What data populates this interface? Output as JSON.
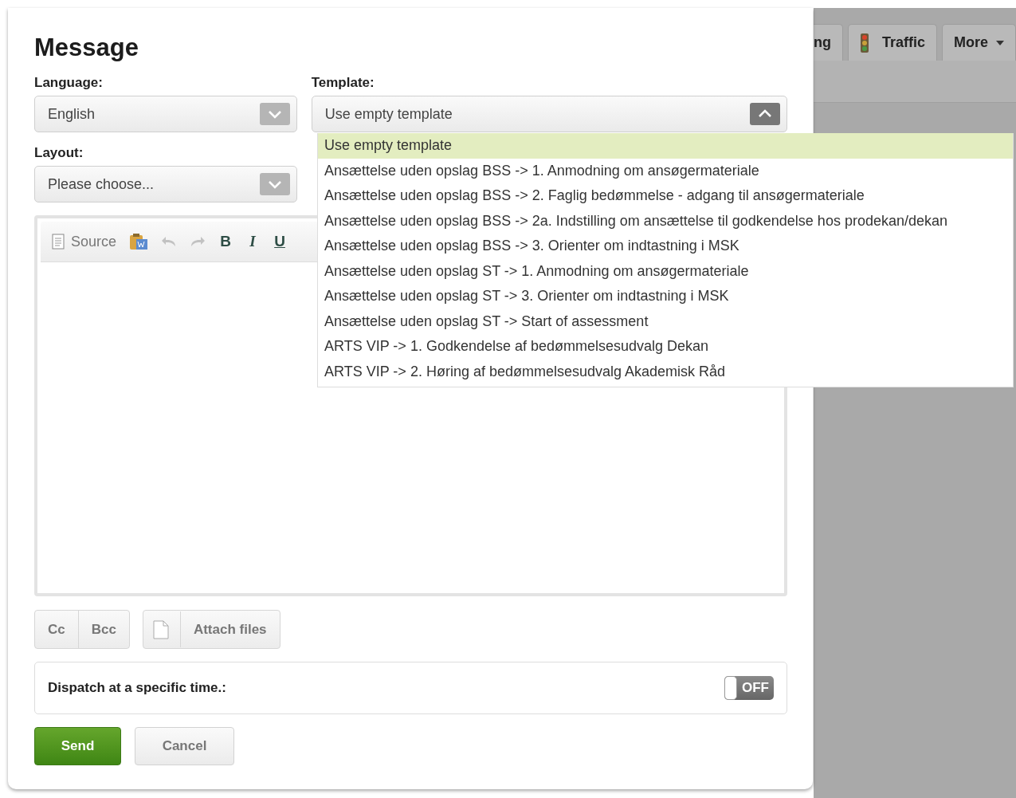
{
  "background_tabs": [
    {
      "kind": "plain",
      "label": "ng"
    },
    {
      "kind": "traffic",
      "label": "Traffic"
    },
    {
      "kind": "menu",
      "label": "More"
    }
  ],
  "dialog": {
    "title": "Message",
    "language": {
      "label": "Language:",
      "value": "English"
    },
    "template": {
      "label": "Template:",
      "value": "Use empty template",
      "expanded": true,
      "options": [
        {
          "label": "Use empty template",
          "selected": true
        },
        {
          "label": "Ansættelse uden opslag BSS -> 1. Anmodning om ansøgermateriale",
          "selected": false
        },
        {
          "label": "Ansættelse uden opslag BSS -> 2. Faglig bedømmelse - adgang til ansøgermateriale",
          "selected": false
        },
        {
          "label": "Ansættelse uden opslag BSS -> 2a. Indstilling om ansættelse til godkendelse hos prodekan/dekan",
          "selected": false
        },
        {
          "label": "Ansættelse uden opslag BSS -> 3. Orienter om indtastning i MSK",
          "selected": false
        },
        {
          "label": "Ansættelse uden opslag ST -> 1. Anmodning om ansøgermateriale",
          "selected": false
        },
        {
          "label": "Ansættelse uden opslag ST -> 3. Orienter om indtastning i MSK",
          "selected": false
        },
        {
          "label": "Ansættelse uden opslag ST -> Start of assessment",
          "selected": false
        },
        {
          "label": "ARTS VIP -> 1. Godkendelse af bedømmelsesudvalg Dekan",
          "selected": false
        },
        {
          "label": "ARTS VIP -> 2. Høring af bedømmelsesudvalg Akademisk Råd",
          "selected": false
        }
      ]
    },
    "layout": {
      "label": "Layout:",
      "value": "Please choose..."
    },
    "toolbar": [
      {
        "kind": "source",
        "label": "Source"
      },
      {
        "kind": "paste-word"
      },
      {
        "kind": "undo"
      },
      {
        "kind": "redo"
      },
      {
        "kind": "bold",
        "label": "B"
      },
      {
        "kind": "italic",
        "label": "I"
      },
      {
        "kind": "underline",
        "label": "U"
      }
    ],
    "recipient_buttons": [
      "Cc",
      "Bcc"
    ],
    "attach_button": "Attach files",
    "dispatch": {
      "label": "Dispatch at a specific time.:",
      "on": false,
      "state_label": "OFF"
    },
    "actions": [
      {
        "kind": "primary",
        "label": "Send"
      },
      {
        "kind": "secondary",
        "label": "Cancel"
      }
    ]
  }
}
